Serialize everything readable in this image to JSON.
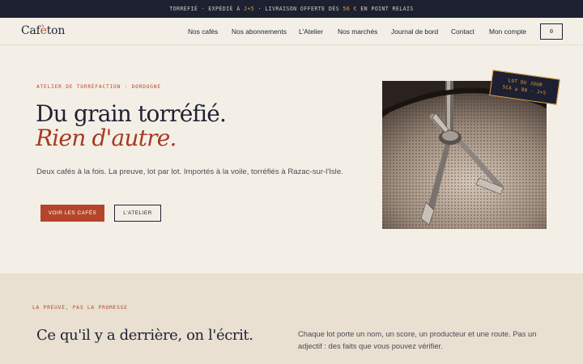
{
  "announcement": {
    "part1": "TORRÉFIÉ · EXPÉDIÉ À ",
    "highlight1": "J+5",
    "part2": " · LIVRAISON OFFERTE DÈS ",
    "highlight2": "56 €",
    "part3": " EN POINT RELAIS"
  },
  "brand": {
    "logo_start": "Caf",
    "logo_accent": "è",
    "logo_end": "ton"
  },
  "nav": {
    "items": [
      {
        "label": "Nos cafés"
      },
      {
        "label": "Nos abonnements"
      },
      {
        "label": "L'Atelier"
      },
      {
        "label": "Nos marchés"
      },
      {
        "label": "Journal de bord"
      },
      {
        "label": "Contact"
      },
      {
        "label": "Mon compte"
      }
    ],
    "cart_count": "0"
  },
  "hero": {
    "eyebrow": "ATELIER DE TORRÉFACTION · DORDOGNE",
    "title_line1": "Du grain torréfié.",
    "title_line2": "Rien d'autre.",
    "lead": "Deux cafés à la fois. La preuve, lot par lot. Importés à la voile, torréfiés à Razac-sur-l'Isle.",
    "cta_primary": "VOIR LES CAFÉS",
    "cta_secondary": "L'ATELIER",
    "stamp_line1": "LOT DU JOUR",
    "stamp_line2": "SCA ≥ 80 · J+5"
  },
  "proof": {
    "eyebrow": "LA PREUVE, PAS LA PROMESSE",
    "title": "Ce qu'il y a derrière, on l'écrit.",
    "text": "Chaque lot porte un nom, un score, un producteur et une route. Pas un adjectif : des faits que vous pouvez vérifier."
  },
  "colors": {
    "accent": "#b5452a",
    "dark": "#1d2030",
    "background": "#f4efe6",
    "section_background": "#e9e0d1",
    "gold": "#e0a243"
  }
}
